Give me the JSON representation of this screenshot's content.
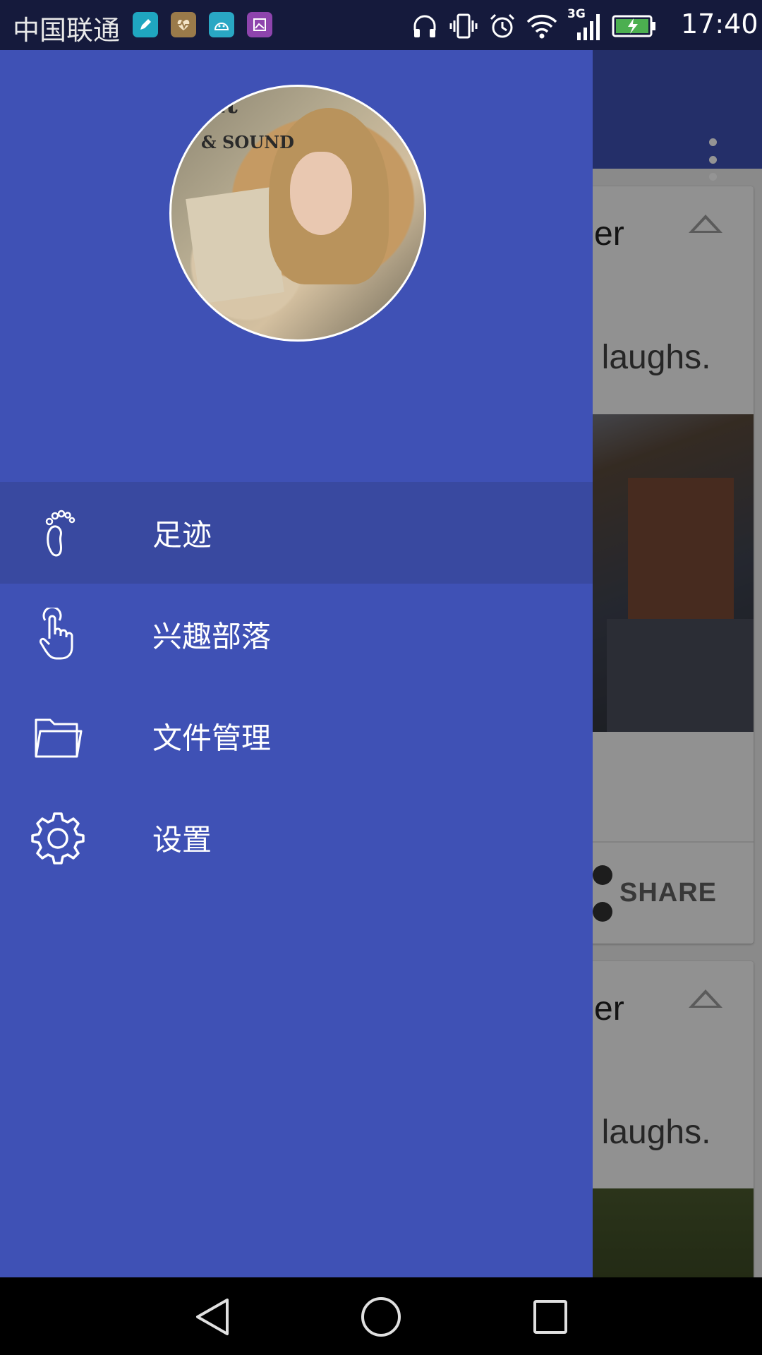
{
  "status_bar": {
    "carrier": "中国联通",
    "time": "17:40",
    "network_type": "3G",
    "notification_icons": [
      "pen-app-icon",
      "health-app-icon",
      "android-app-icon",
      "gallery-app-icon"
    ],
    "system_icons": [
      "headphones-icon",
      "vibrate-icon",
      "alarm-icon",
      "wifi-icon",
      "signal-icon",
      "battery-charging-icon"
    ]
  },
  "drawer": {
    "menu_items": [
      {
        "label": "足迹",
        "icon": "footprint-icon",
        "active": true
      },
      {
        "label": "兴趣部落",
        "icon": "touch-hand-icon",
        "active": false
      },
      {
        "label": "文件管理",
        "icon": "folder-icon",
        "active": false
      },
      {
        "label": "设置",
        "icon": "gear-icon",
        "active": false
      }
    ],
    "avatar_text_line1": "ift",
    "avatar_text_line2": "& SOUND"
  },
  "background": {
    "cards": [
      {
        "title_fragment": "er",
        "body_fragment": "f laughs.",
        "action_label": "SHARE"
      },
      {
        "title_fragment": "er",
        "body_fragment": "f laughs."
      }
    ]
  },
  "colors": {
    "primary": "#3F51B5",
    "active_item": "#3949A0",
    "status_bar": "#151a3c"
  }
}
